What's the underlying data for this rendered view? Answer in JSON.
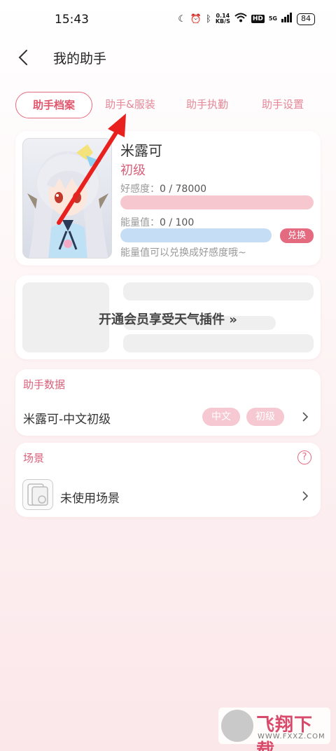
{
  "status_bar": {
    "time": "15:43",
    "net_speed_value": "0.14",
    "net_speed_unit": "KB/S",
    "hd": "HD",
    "signal": "5G",
    "battery": "84",
    "icons": [
      "moon-icon",
      "alarm-icon",
      "bluetooth-icon",
      "wifi-icon",
      "cellular-signal-icon",
      "battery-icon"
    ]
  },
  "header": {
    "title": "我的助手"
  },
  "tabs": [
    {
      "label": "助手档案",
      "active": true
    },
    {
      "label": "助手&服装",
      "active": false
    },
    {
      "label": "助手执勤",
      "active": false
    },
    {
      "label": "助手设置",
      "active": false
    }
  ],
  "profile": {
    "name": "米露可",
    "level": "初级",
    "favor_label": "好感度：",
    "favor_value": "0 / 78000",
    "favor_current": 0,
    "favor_max": 78000,
    "energy_label": "能量值：",
    "energy_value": "0 / 100",
    "energy_current": 0,
    "energy_max": 100,
    "redeem_label": "兑换",
    "energy_tip": "能量值可以兑换成好感度哦~"
  },
  "weather_card": {
    "cta": "开通会员享受天气插件 »"
  },
  "assistant_data": {
    "title": "助手数据",
    "row_label": "米露可-中文初级",
    "tags": [
      "中文",
      "初级"
    ]
  },
  "scene": {
    "title": "场景",
    "help": "?",
    "row_label": "未使用场景"
  },
  "watermark": {
    "text": "飞翔下载",
    "url": "WWW.FXXZ.COM"
  },
  "colors": {
    "accent": "#e0566d",
    "accent_light": "#f6c9d2",
    "favor_bar": "#f7c7cf",
    "energy_bar": "#c5def5",
    "arrow": "#e8201e"
  }
}
